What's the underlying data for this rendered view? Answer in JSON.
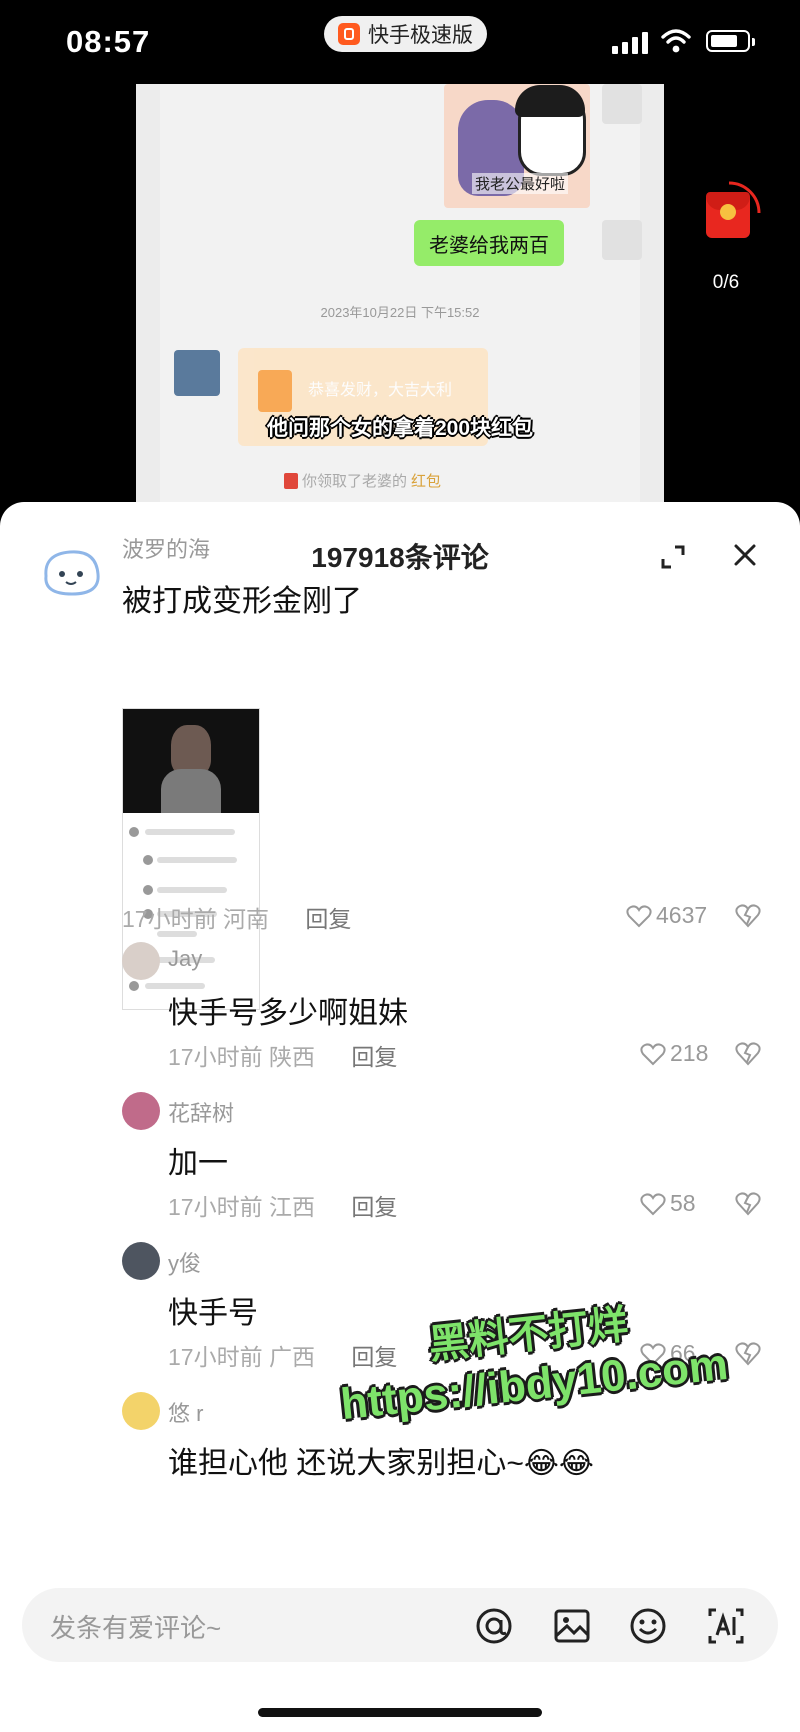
{
  "status_bar": {
    "time": "08:57",
    "app_pill": "快手极速版"
  },
  "video": {
    "sticker_caption": "我老公最好啦",
    "green_bubble": "老婆给我两百",
    "chat_timestamp": "2023年10月22日 下午15:52",
    "redpacket_text": "恭喜发财，大吉大利",
    "subtitle": "他问那个女的拿着200块红包",
    "claimed_prefix": "你领取了老婆的",
    "claimed_highlight": "红包"
  },
  "redpacket_widget": {
    "count": "0/6"
  },
  "panel": {
    "title": "197918条评论",
    "comments": [
      {
        "user": "波罗的海",
        "text": "被打成变形金刚了",
        "time": "17小时前",
        "location": "河南",
        "reply": "回复",
        "likes": "4637"
      },
      {
        "user": "Jay",
        "text": "快手号多少啊姐妹",
        "time": "17小时前",
        "location": "陕西",
        "reply": "回复",
        "likes": "218"
      },
      {
        "user": "花辞树",
        "text": "加一",
        "time": "17小时前",
        "location": "江西",
        "reply": "回复",
        "likes": "58"
      },
      {
        "user": "y俊",
        "text": "快手号",
        "time": "17小时前",
        "location": "广西",
        "reply": "回复",
        "likes": "66"
      },
      {
        "user": "悠 r",
        "text": "谁担心他 还说大家别担心~😂😂"
      }
    ]
  },
  "input_bar": {
    "placeholder": "发条有爱评论~"
  },
  "watermark": {
    "line1": "黑料不打烊",
    "line2": "https://ibdy10.com"
  },
  "colors": {
    "accent_green": "#95ec69",
    "watermark_green": "#7ee36a",
    "red": "#e8271f"
  }
}
